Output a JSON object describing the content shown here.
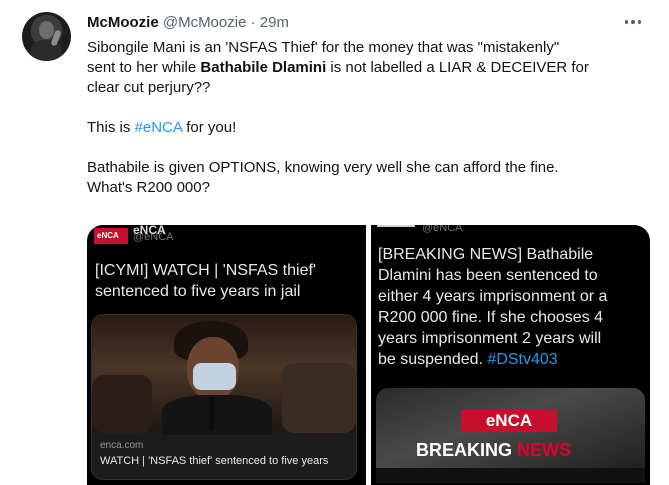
{
  "tweet": {
    "name": "McMoozie",
    "handle": "@McMoozie",
    "dot": "·",
    "time": "29m",
    "line1": "Sibongile Mani is an 'NSFAS Thief' for the money that was \"mistakenly\"",
    "line2_pre": "sent to her while ",
    "line2_bold": "Bathabile Dlamini",
    "line2_post": " is not labelled a LIAR & DECEIVER for",
    "line3": "clear cut perjury??",
    "p2_pre": "This is ",
    "p2_hashtag": "#eNCA",
    "p2_post": " for you!",
    "p3_line1": "Bathabile is given OPTIONS, knowing very well she can afford the fine.",
    "p3_line2": "What's R200 000?"
  },
  "media": {
    "left": {
      "logo_text": "eNCA",
      "account_name": "eNCA",
      "account_handle": "@eNCA",
      "headline_l1": "[ICYMI] WATCH | 'NSFAS thief'",
      "headline_l2": "sentenced to five years in jail",
      "domain": "enca.com",
      "caption": "WATCH | 'NSFAS thief' sentenced to five years"
    },
    "right": {
      "account_handle": "@eNCA",
      "text_l1": "[BREAKING NEWS] Bathabile",
      "text_l2": "Dlamini has been sentenced to",
      "text_l3": "either 4 years imprisonment or a",
      "text_l4": "R200 000 fine. If she chooses 4",
      "text_l5": "years imprisonment 2 years will",
      "text_l6_pre": "be suspended. ",
      "text_l6_hashtag": "#DStv403",
      "promo_logo": "eNCA",
      "promo_breaking": "BREAKING",
      "promo_news": "NEWS"
    }
  },
  "colors": {
    "accent": "#1d9bf0",
    "brand_red": "#c8102e",
    "text": "#0f1419",
    "secondary": "#536471"
  },
  "icons": {
    "more": "more-horizontal-icon"
  }
}
